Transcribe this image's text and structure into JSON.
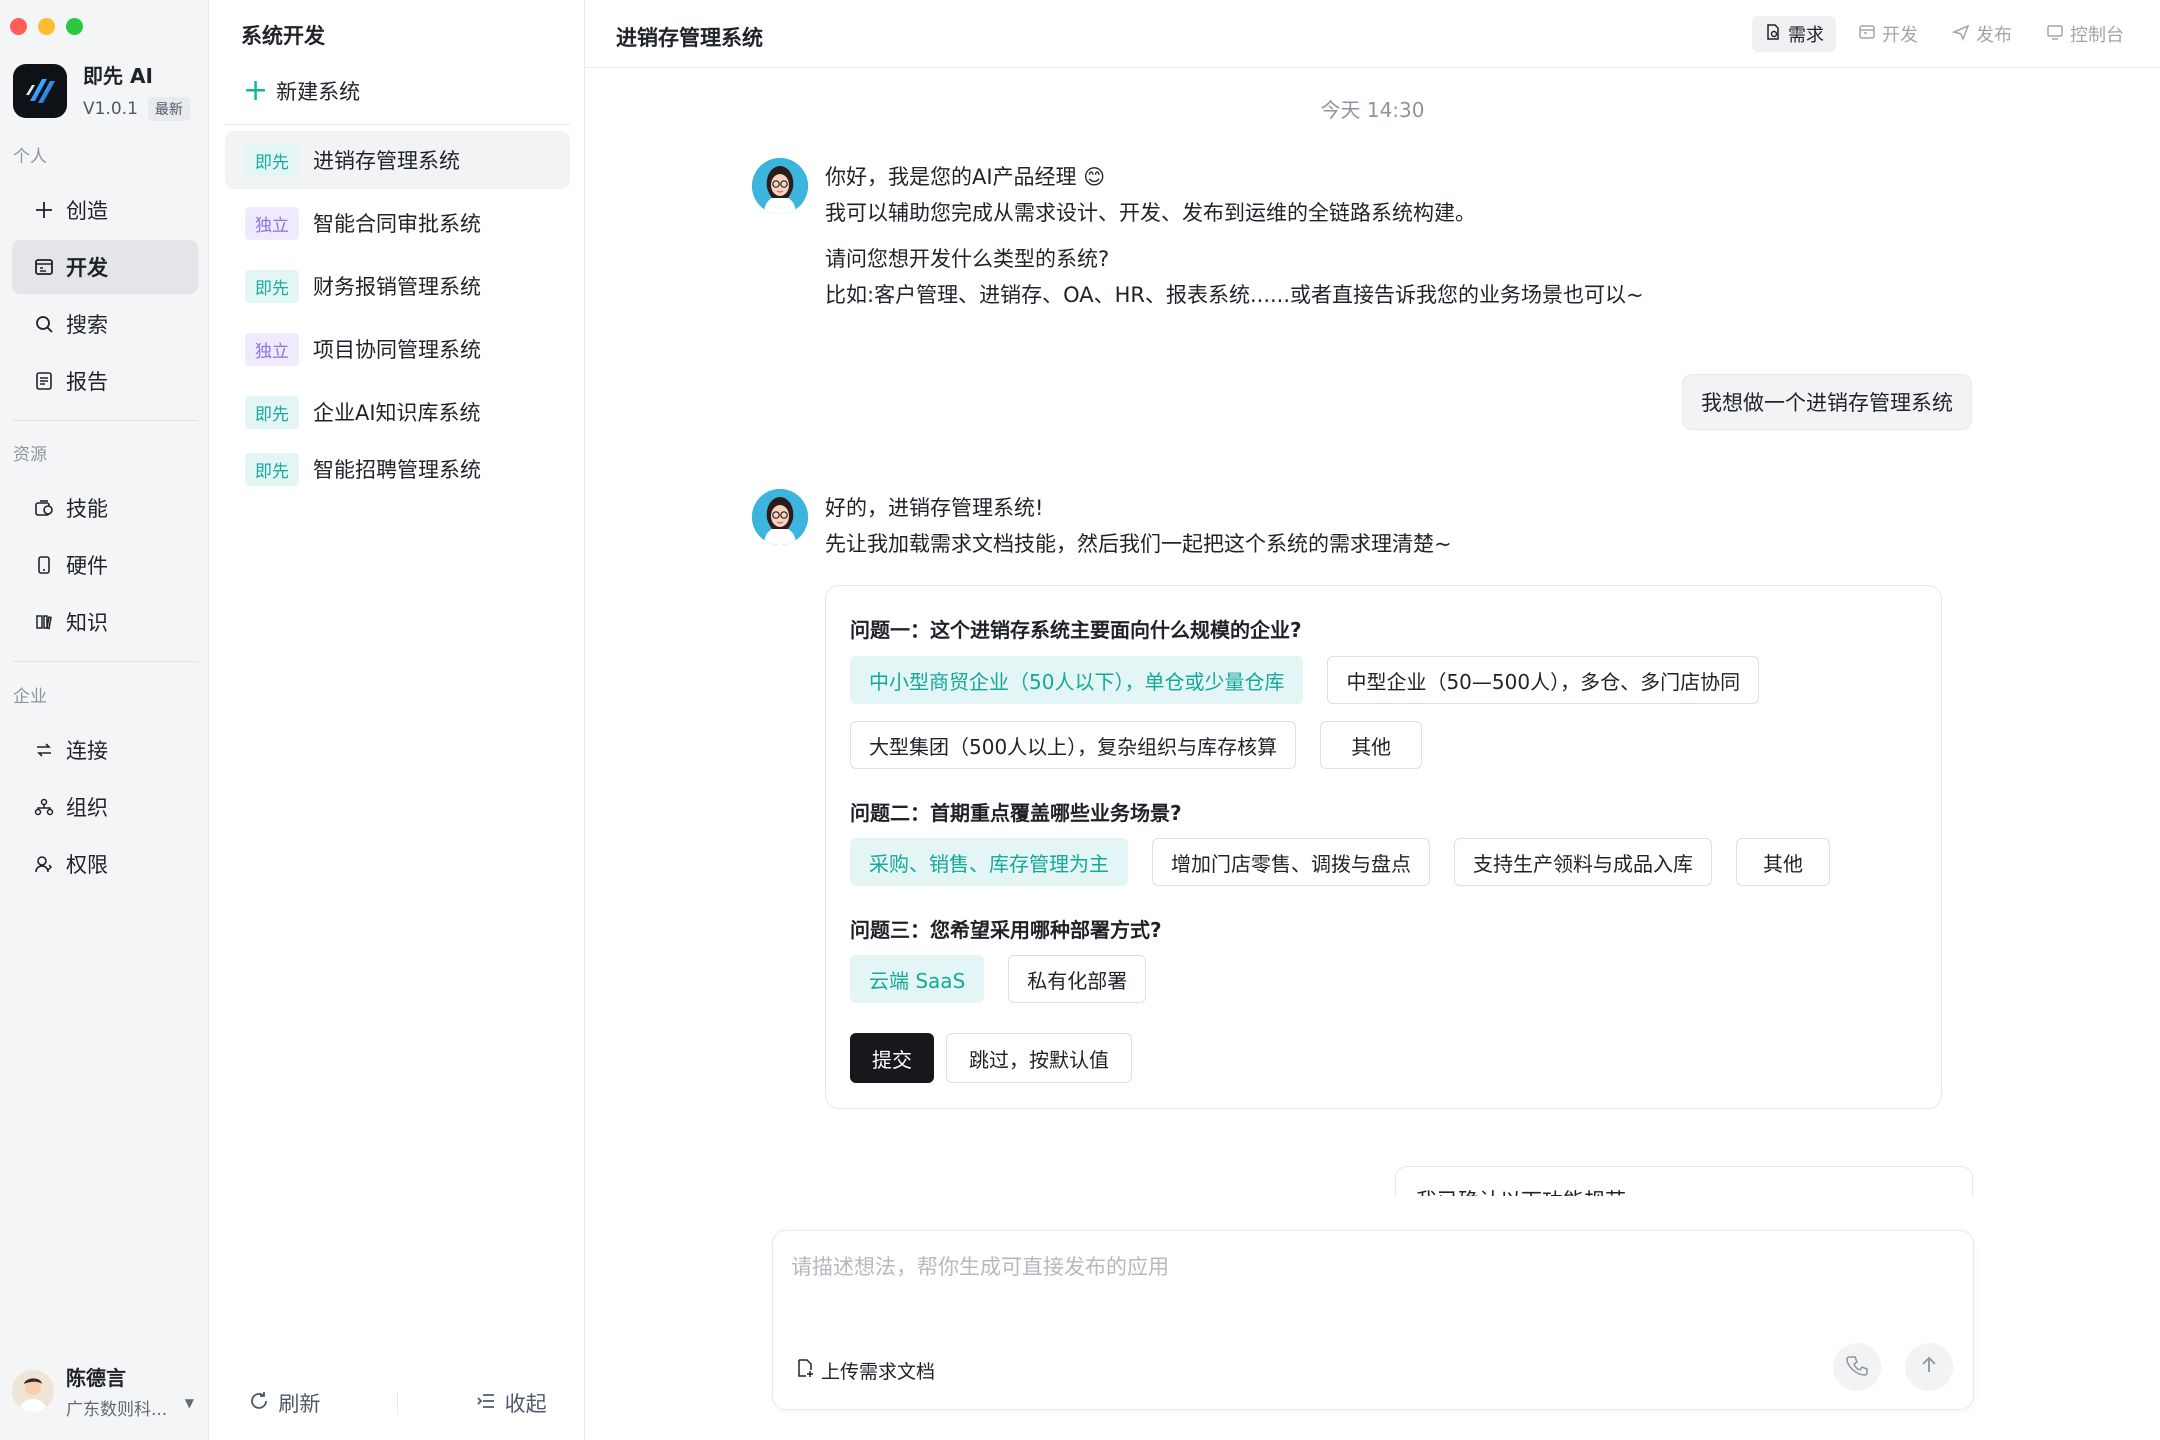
{
  "app": {
    "name": "即先 AI",
    "version": "V1.0.1",
    "version_badge": "最新"
  },
  "nav": {
    "section_personal": "个人",
    "section_resources": "资源",
    "section_enterprise": "企业",
    "items": [
      {
        "label": "创造",
        "icon": "plus-icon"
      },
      {
        "label": "开发",
        "icon": "dev-window-icon"
      },
      {
        "label": "搜索",
        "icon": "search-icon"
      },
      {
        "label": "报告",
        "icon": "report-icon"
      },
      {
        "label": "技能",
        "icon": "skill-icon"
      },
      {
        "label": "硬件",
        "icon": "phone-icon"
      },
      {
        "label": "知识",
        "icon": "book-icon"
      },
      {
        "label": "连接",
        "icon": "connect-icon"
      },
      {
        "label": "组织",
        "icon": "org-icon"
      },
      {
        "label": "权限",
        "icon": "permission-icon"
      }
    ],
    "active": "开发"
  },
  "user": {
    "name": "陈德言",
    "org": "广东数则科..."
  },
  "projects": {
    "title": "系统开发",
    "new_label": "新建系统",
    "items": [
      {
        "tag": "即先",
        "name": "进销存管理系统"
      },
      {
        "tag": "独立",
        "name": "智能合同审批系统"
      },
      {
        "tag": "即先",
        "name": "财务报销管理系统"
      },
      {
        "tag": "独立",
        "name": "项目协同管理系统"
      },
      {
        "tag": "即先",
        "name": "企业AI知识库系统"
      },
      {
        "tag": "即先",
        "name": "智能招聘管理系统"
      }
    ],
    "refresh_label": "刷新",
    "collapse_label": "收起"
  },
  "main": {
    "title": "进销存管理系统",
    "tabs": [
      {
        "label": "需求",
        "icon": "requirement-icon"
      },
      {
        "label": "开发",
        "icon": "dev-window-icon"
      },
      {
        "label": "发布",
        "icon": "send-icon"
      },
      {
        "label": "控制台",
        "icon": "monitor-icon"
      }
    ],
    "active_tab": "需求"
  },
  "chat": {
    "timestamp": "今天 14:30",
    "bot_msg1": {
      "line1": "你好，我是您的AI产品经理 😊",
      "line2": "我可以辅助您完成从需求设计、开发、发布到运维的全链路系统构建。",
      "line3": "请问您想开发什么类型的系统?",
      "line4": "比如:客户管理、进销存、OA、HR、报表系统......或者直接告诉我您的业务场景也可以~"
    },
    "user_msg": "我想做一个进销存管理系统",
    "bot_msg2": {
      "line1": "好的，进销存管理系统!",
      "line2": "先让我加载需求文档技能，然后我们一起把这个系统的需求理清楚~"
    },
    "questions": [
      {
        "title": "问题一：这个进销存系统主要面向什么规模的企业?",
        "row1": [
          "中小型商贸企业（50人以下），单仓或少量仓库",
          "中型企业（50—500人），多仓、多门店协同"
        ],
        "row2": [
          "大型集团（500人以上），复杂组织与库存核算",
          "其他"
        ],
        "selected": "中小型商贸企业（50人以下），单仓或少量仓库"
      },
      {
        "title": "问题二：首期重点覆盖哪些业务场景?",
        "row1": [
          "采购、销售、库存管理为主",
          "增加门店零售、调拨与盘点",
          "支持生产领料与成品入库",
          "其他"
        ],
        "selected": "采购、销售、库存管理为主"
      },
      {
        "title": "问题三：您希望采用哪种部署方式?",
        "row1": [
          "云端 SaaS",
          "私有化部署"
        ],
        "selected": "云端 SaaS"
      }
    ],
    "submit_label": "提交",
    "skip_label": "跳过，按默认值",
    "peek_text": "我已确认以下功能规范"
  },
  "composer": {
    "placeholder": "请描述想法，帮你生成可直接发布的应用",
    "upload_label": "上传需求文档"
  },
  "colors": {
    "accent": "#14a898",
    "accent_bg": "#e3f6f5",
    "purple_tag": "#8c6ee6",
    "dark_button": "#16181c"
  }
}
